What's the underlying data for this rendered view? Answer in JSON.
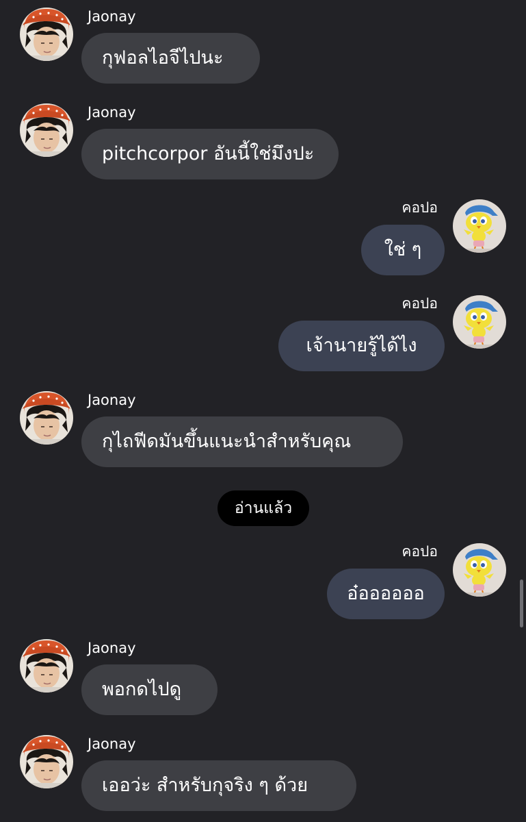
{
  "messages": [
    {
      "sender": "Jaonay",
      "text": "กุฟอลไอจีไปนะ",
      "side": "in",
      "avatar": "man-with-orange-cap"
    },
    {
      "sender": "Jaonay",
      "text": "pitchcorpor อันนี้ใช่มึงปะ",
      "side": "in",
      "avatar": "man-with-orange-cap"
    },
    {
      "sender": "คอปอ",
      "text": "ใช่ ๆ",
      "side": "out",
      "avatar": "yellow-bird-cartoon"
    },
    {
      "sender": "คอปอ",
      "text": "เจ้านายรู้ได้ไง",
      "side": "out",
      "avatar": "yellow-bird-cartoon"
    },
    {
      "sender": "Jaonay",
      "text": "กุไถฟีดมันขึ้นแนะนำสำหรับคุณ",
      "side": "in",
      "avatar": "man-with-orange-cap"
    },
    {
      "sender": "คอปอ",
      "text": "อ๋ออออออ",
      "side": "out",
      "avatar": "yellow-bird-cartoon"
    },
    {
      "sender": "Jaonay",
      "text": "พอกดไปดู",
      "side": "in",
      "avatar": "man-with-orange-cap"
    },
    {
      "sender": "Jaonay",
      "text": "เออว่ะ สำหรับกุจริง ๆ ด้วย",
      "side": "in",
      "avatar": "man-with-orange-cap"
    }
  ],
  "read_receipt": "อ่านแล้ว",
  "colors": {
    "background": "#222226",
    "incoming_bubble": "#3e3f44",
    "outgoing_bubble": "#3c4253",
    "read_pill": "#000000"
  }
}
